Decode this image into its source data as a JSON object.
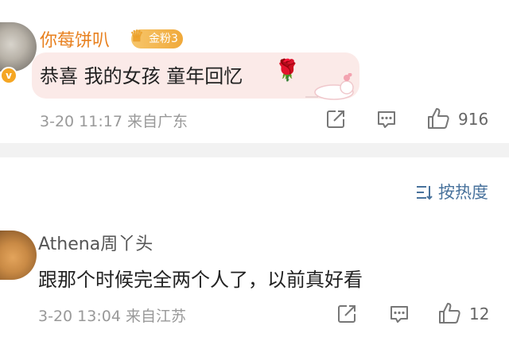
{
  "comments": [
    {
      "username": "你莓饼叭",
      "fan_badge": "金粉3",
      "text": "恭喜 我的女孩 童年回忆",
      "time": "3-20 11:17",
      "location": "来自广东",
      "likes": "916",
      "emoji_icon": "rose-icon",
      "verified": true
    },
    {
      "username": "Athena周丫头",
      "text": "跟那个时候完全两个人了，以前真好看",
      "time": "3-20 13:04",
      "location": "来自江苏",
      "likes": "12"
    }
  ],
  "sort": {
    "label": "按热度"
  },
  "colors": {
    "username_highlight": "#e8801e",
    "link_blue": "#48729c",
    "bubble_bg": "#fbeae8"
  }
}
